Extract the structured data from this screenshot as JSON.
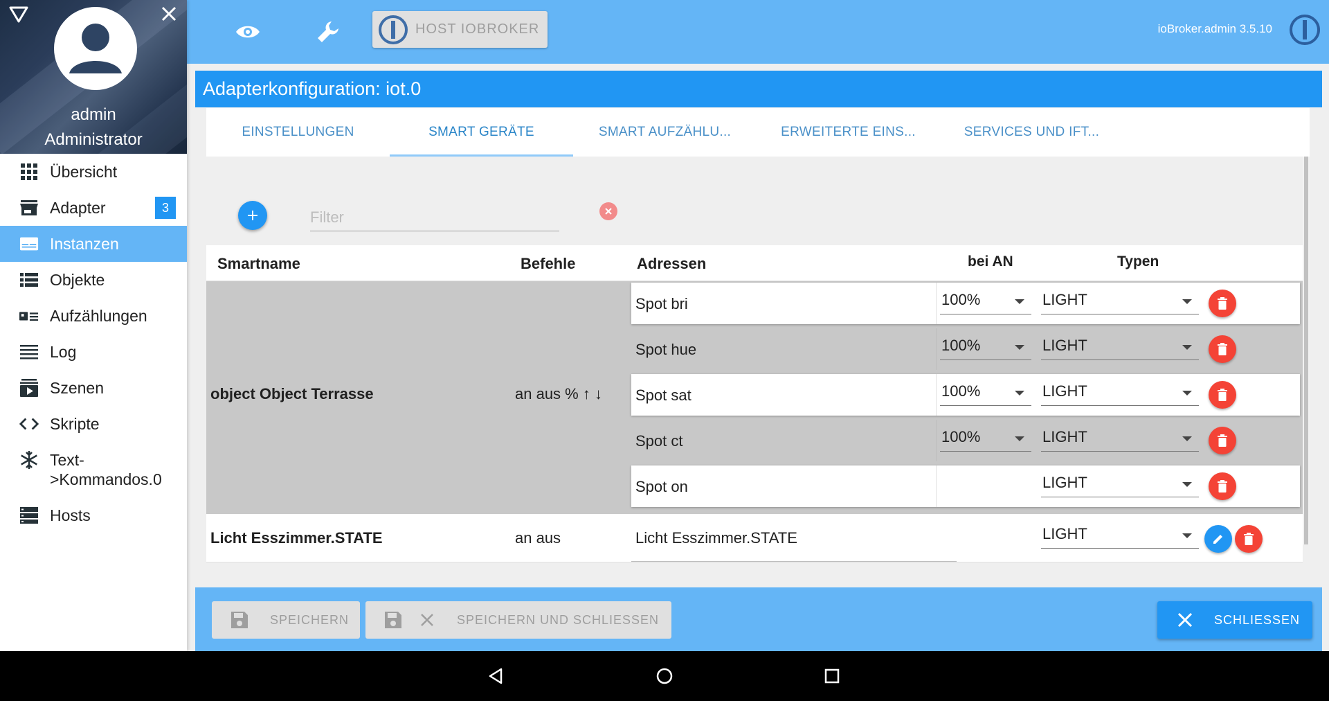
{
  "user": {
    "name": "admin",
    "role": "Administrator"
  },
  "sidebar": {
    "items": [
      {
        "label": "Übersicht",
        "icon": "grid-icon"
      },
      {
        "label": "Adapter",
        "icon": "store-icon",
        "badge": "3"
      },
      {
        "label": "Instanzen",
        "icon": "instances-icon",
        "active": true
      },
      {
        "label": "Objekte",
        "icon": "list-icon"
      },
      {
        "label": "Aufzählungen",
        "icon": "enum-icon"
      },
      {
        "label": "Log",
        "icon": "log-icon"
      },
      {
        "label": "Szenen",
        "icon": "scenes-icon"
      },
      {
        "label": "Skripte",
        "icon": "code-icon"
      },
      {
        "label": "Text->Kommandos.0",
        "label_line1": "Text-",
        "label_line2": ">Kommandos.0",
        "icon": "snowflake-icon"
      },
      {
        "label": "Hosts",
        "icon": "hosts-icon"
      }
    ]
  },
  "topbar": {
    "host_label": "HOST IOBROKER",
    "version": "ioBroker.admin 3.5.10"
  },
  "dialog": {
    "title": "Adapterkonfiguration: iot.0",
    "tabs": [
      {
        "label": "EINSTELLUNGEN"
      },
      {
        "label": "SMART GERÄTE",
        "active": true
      },
      {
        "label": "SMART AUFZÄHLU..."
      },
      {
        "label": "ERWEITERTE EINS..."
      },
      {
        "label": "SERVICES UND IFT..."
      }
    ]
  },
  "filter": {
    "placeholder": "Filter",
    "value": ""
  },
  "table": {
    "headers": {
      "smartname": "Smartname",
      "commands": "Befehle",
      "addresses": "Adressen",
      "on_value": "bei AN",
      "types": "Typen"
    },
    "rows": [
      {
        "smartname": "object Object Terrasse",
        "commands": "an aus % ↑ ↓",
        "addresses": [
          {
            "name": "Spot bri",
            "on": "100%",
            "type": "LIGHT"
          },
          {
            "name": "Spot hue",
            "on": "100%",
            "type": "LIGHT"
          },
          {
            "name": "Spot sat",
            "on": "100%",
            "type": "LIGHT"
          },
          {
            "name": "Spot ct",
            "on": "100%",
            "type": "LIGHT"
          },
          {
            "name": "Spot on",
            "on": "",
            "type": "LIGHT"
          }
        ]
      },
      {
        "smartname": "Licht Esszimmer.STATE",
        "commands": "an aus",
        "address": "Licht Esszimmer.STATE",
        "type": "LIGHT"
      }
    ]
  },
  "footer": {
    "save": "SPEICHERN",
    "save_close": "SPEICHERN UND SCHLIESSEN",
    "close": "SCHLIESSEN"
  },
  "colors": {
    "header_blue": "#64b5f6",
    "accent_blue": "#2196f3",
    "delete_red": "#f44336"
  }
}
